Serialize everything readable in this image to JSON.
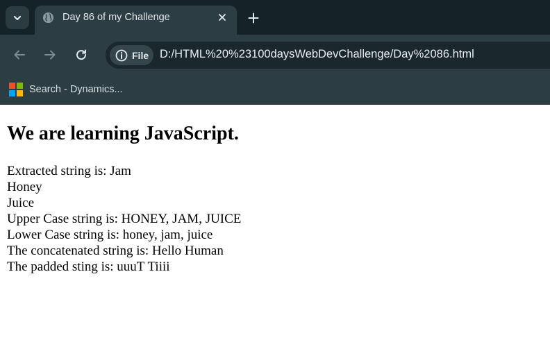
{
  "browser": {
    "tab": {
      "title": "Day 86 of my Challenge"
    },
    "address_bar": {
      "scheme_label": "File",
      "url": "D:/HTML%20%23100daysWebDevChallenge/Day%2086.html"
    },
    "bookmarks": [
      {
        "label": "Search - Dynamics..."
      }
    ]
  },
  "page": {
    "heading": "We are learning JavaScript.",
    "lines": [
      "Extracted string is: Jam",
      "Honey",
      "Juice",
      "Upper Case string is: HONEY, JAM, JUICE",
      "Lower Case string is: honey, jam, juice",
      "The concatenated string is: Hello Human",
      "The padded sting is: uuuT Tiiii"
    ]
  },
  "colors": {
    "tabstrip_bg": "#152328",
    "toolbar_bg": "#2d3d44",
    "omnibox_bg": "#1a272c",
    "page_bg": "#ffffff",
    "ms_logo": [
      "#f25022",
      "#7fba00",
      "#00a4ef",
      "#ffb900"
    ]
  },
  "icons": {
    "tab_search": "chevron-down-icon",
    "favicon": "globe-icon",
    "close": "close-icon",
    "new_tab": "plus-icon",
    "back": "arrow-left-icon",
    "forward": "arrow-right-icon",
    "reload": "reload-icon",
    "info": "info-icon",
    "bookmark": "microsoft-logo-icon"
  }
}
